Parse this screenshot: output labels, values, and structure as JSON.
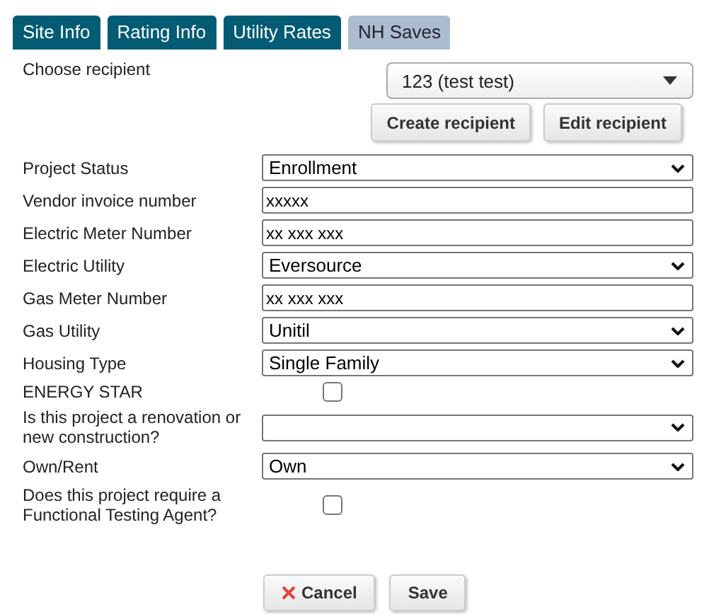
{
  "tabs": [
    {
      "label": "Site Info",
      "selected": false
    },
    {
      "label": "Rating Info",
      "selected": false
    },
    {
      "label": "Utility Rates",
      "selected": false
    },
    {
      "label": "NH Saves",
      "selected": true
    }
  ],
  "recipient": {
    "label": "Choose recipient",
    "value": "123 (test test)",
    "buttons": [
      "Create recipient",
      "Edit recipient"
    ]
  },
  "fields": [
    {
      "kind": "select",
      "label": "Project Status",
      "value": "Enrollment"
    },
    {
      "kind": "text",
      "label": "Vendor invoice number",
      "value": "xxxxx"
    },
    {
      "kind": "text",
      "label": "Electric Meter Number",
      "value": "xx xxx xxx"
    },
    {
      "kind": "select",
      "label": "Electric Utility",
      "value": "Eversource"
    },
    {
      "kind": "text",
      "label": "Gas Meter Number",
      "value": "xx xxx xxx"
    },
    {
      "kind": "select",
      "label": "Gas Utility",
      "value": "Unitil"
    },
    {
      "kind": "select",
      "label": "Housing Type",
      "value": "Single Family"
    },
    {
      "kind": "checkbox",
      "label": "ENERGY STAR",
      "checked": false
    },
    {
      "kind": "select",
      "label": "Is this project a renovation or new construction?"
    },
    {
      "kind": "select",
      "label": "Own/Rent",
      "value": "Own"
    },
    {
      "kind": "checkbox",
      "label": "Does this project require a Functional Testing Agent?",
      "checked": false
    }
  ],
  "actions": {
    "cancel": "Cancel",
    "save": "Save"
  }
}
